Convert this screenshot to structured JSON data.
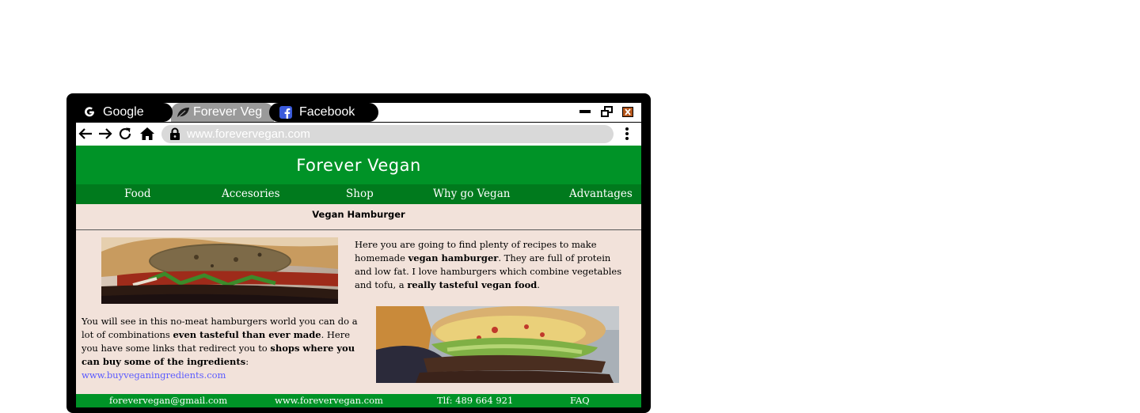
{
  "browser": {
    "tabs": [
      {
        "label": "Google",
        "icon": "google-icon"
      },
      {
        "label": "Forever Veg",
        "icon": "leaf-icon"
      },
      {
        "label": "Facebook",
        "icon": "facebook-icon"
      }
    ],
    "url": "www.forevervegan.com"
  },
  "site": {
    "title": "Forever Vegan",
    "menu": [
      "Food",
      "Accesories",
      "Shop",
      "Why go Vegan",
      "Advantages"
    ]
  },
  "article": {
    "heading": "Vegan Hamburger",
    "p1": {
      "a": "Here you are going to find plenty of recipes to make homemade ",
      "b": "vegan hamburger",
      "c": ". They are full of protein and low fat. I love hamburgers which combine vegetables and tofu, a ",
      "d": "really tasteful vegan food",
      "e": "."
    },
    "p2": {
      "a": "You will see in this no-meat hamburgers world you can do a lot of combinations ",
      "b": "even tasteful than ever made",
      "c": ". Here you have some links that redirect you to ",
      "d": "shops where you can buy some of the ingredients",
      "e": ": ",
      "link": "www.buyveganingredients.com"
    }
  },
  "footer": {
    "email": "forevervegan@gmail.com",
    "site": "www.forevervegan.com",
    "phone": "Tlf: 489 664 921",
    "faq": "FAQ"
  },
  "colors": {
    "header_green": "#009327",
    "menu_green": "#007a1d",
    "content_bg": "#f2e2da",
    "link": "#5a5aff"
  }
}
